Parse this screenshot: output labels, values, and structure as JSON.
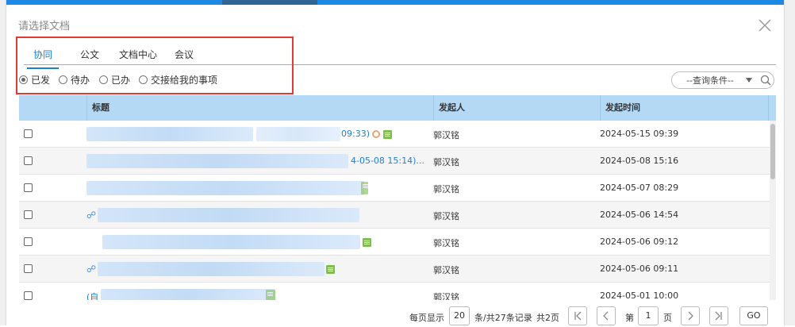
{
  "dialog": {
    "title": "请选择文档"
  },
  "tabs": [
    {
      "label": "协同",
      "active": true
    },
    {
      "label": "公文"
    },
    {
      "label": "文档中心"
    },
    {
      "label": "会议"
    }
  ],
  "filters": [
    {
      "label": "已发",
      "checked": true
    },
    {
      "label": "待办"
    },
    {
      "label": "已办"
    },
    {
      "label": "交接给我的事项"
    }
  ],
  "query": {
    "label": "--查询条件--"
  },
  "table": {
    "columns": [
      "标题",
      "发起人",
      "发起时间"
    ],
    "rows": [
      {
        "title_suffix": "09:33)",
        "sender": "郭汉铭",
        "time": "2024-05-15 09:39"
      },
      {
        "title_suffix": "4-05-08 15:14)...",
        "sender": "郭汉铭",
        "time": "2024-05-08 15:16"
      },
      {
        "title_suffix": "",
        "sender": "郭汉铭",
        "time": "2024-05-07 08:29"
      },
      {
        "title_suffix": "",
        "sender": "郭汉铭",
        "time": "2024-05-06 14:54"
      },
      {
        "title_suffix": "",
        "sender": "郭汉铭",
        "time": "2024-05-06 09:12"
      },
      {
        "title_suffix": "",
        "sender": "郭汉铭",
        "time": "2024-05-06 09:11"
      },
      {
        "title_suffix": "(自",
        "sender": "郭汉铭",
        "time": "2024-05-01 10:00"
      }
    ]
  },
  "pager": {
    "per_page_label": "每页显示",
    "per_page": "20",
    "total_text": "条/共27条记录",
    "pages_text": "共2页",
    "page_prefix": "第",
    "page": "1",
    "page_suffix": "页",
    "go": "GO"
  }
}
